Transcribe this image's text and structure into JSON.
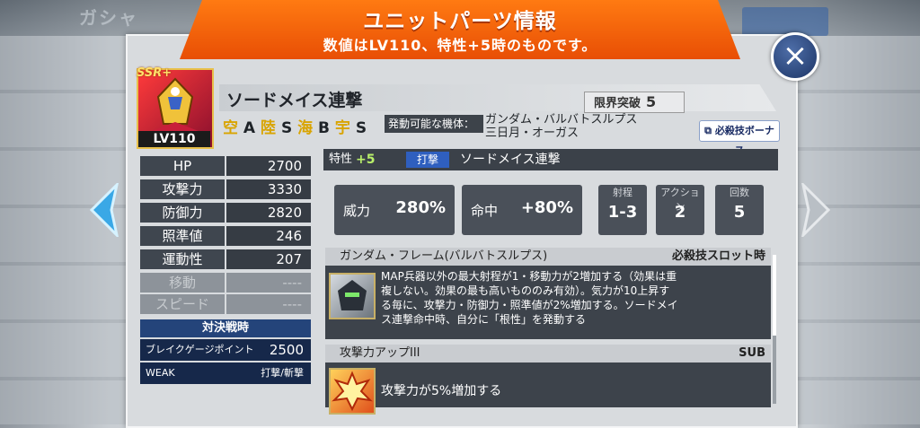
{
  "background": {
    "back_label": "ガシャ"
  },
  "header": {
    "title": "ユニットパーツ情報",
    "subtitle": "数値はLV110、特性+5時のものです。"
  },
  "unit": {
    "rarity": "SSR+",
    "level": "LV110",
    "name": "ソードメイス連撃",
    "terrain": {
      "air": "空",
      "air_rank": "A",
      "land": "陸",
      "land_rank": "S",
      "sea": "海",
      "sea_rank": "B",
      "space": "宇",
      "space_rank": "S"
    },
    "limit_break_label": "限界突破",
    "limit_break_value": "5",
    "compat_label": "発動可能な機体：",
    "compat_line1": "ガンダム・バルバトスルプス",
    "compat_line2": "三日月・オーガス",
    "special_bonus_button": "必殺技ボーナス"
  },
  "stats": [
    {
      "label": "HP",
      "value": "2700"
    },
    {
      "label": "攻撃力",
      "value": "3330"
    },
    {
      "label": "防御力",
      "value": "2820"
    },
    {
      "label": "照準値",
      "value": "246"
    },
    {
      "label": "運動性",
      "value": "207"
    },
    {
      "label": "移動",
      "value": "----"
    },
    {
      "label": "スピード",
      "value": "----"
    }
  ],
  "pvp": {
    "title": "対決戦時",
    "break_label": "ブレイクゲージポイント",
    "break_value": "2500",
    "weak_label": "WEAK",
    "weak_value": "打撃/斬撃"
  },
  "trait": {
    "label": "特性",
    "plus": "+5",
    "category": "打撃",
    "name": "ソードメイス連撃"
  },
  "attack": {
    "power_label": "威力",
    "power_value": "280%",
    "accuracy_label": "命中",
    "accuracy_value": "+80%",
    "range_label": "射程",
    "range_value": "1-3",
    "action_label": "アクション",
    "action_value": "2",
    "count_label": "回数",
    "count_value": "5"
  },
  "skills": [
    {
      "name": "ガンダム・フレーム(バルバトスルプス)",
      "tag": "必殺技スロット時",
      "desc1": "MAP兵器以外の最大射程が1・移動力が2増加する（効果は重",
      "desc2": "複しない。効果の最も高いもののみ有効）。気力が10上昇す",
      "desc3": "る毎に、攻撃力・防御力・照準値が2%増加する。ソードメイ",
      "desc4": "ス連撃命中時、自分に「根性」を発動する"
    },
    {
      "name": "攻撃力アップIII",
      "tag": "SUB",
      "desc1": "攻撃力が5%増加する"
    }
  ]
}
